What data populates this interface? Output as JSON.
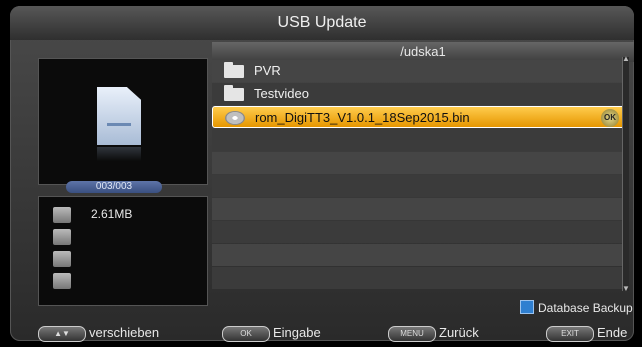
{
  "header": {
    "title": "USB Update"
  },
  "path": "/udska1",
  "preview": {
    "counter": "003/003",
    "size": "2.61MB"
  },
  "files": [
    {
      "name": "PVR",
      "type": "folder",
      "selected": false
    },
    {
      "name": "Testvideo",
      "type": "folder",
      "selected": false
    },
    {
      "name": "rom_DigiTT3_V1.0.1_18Sep2015.bin",
      "type": "file",
      "selected": true,
      "badge": "OK"
    }
  ],
  "options": {
    "database_backup": "Database Backup",
    "database_backup_color": "#2f7fd0"
  },
  "footer": {
    "keys": [
      {
        "key": "▲▼",
        "label": "verschieben"
      },
      {
        "key": "OK",
        "label": "Eingabe"
      },
      {
        "key": "MENU",
        "label": "Zurück"
      },
      {
        "key": "EXIT",
        "label": "Ende"
      }
    ]
  },
  "colors": {
    "selection": "#f2ad1f",
    "accent": "#5d74a8"
  }
}
